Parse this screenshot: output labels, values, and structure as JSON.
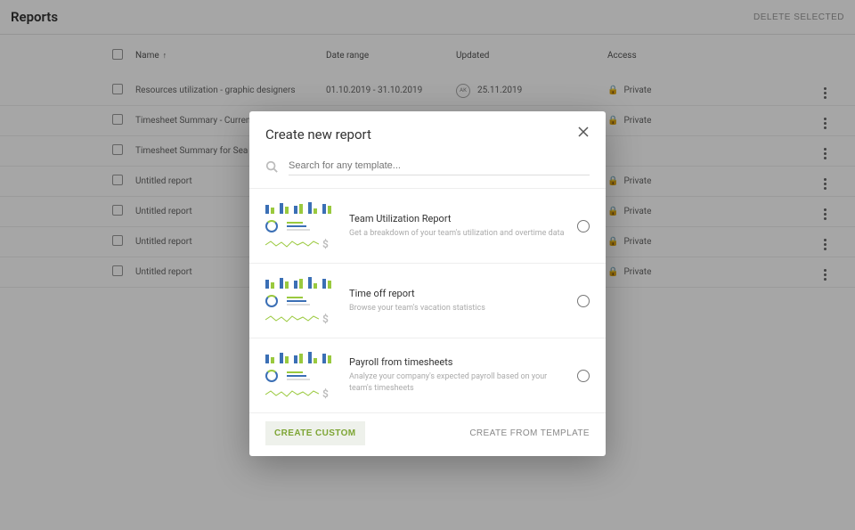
{
  "header": {
    "title": "Reports",
    "delete_label": "DELETE SELECTED"
  },
  "table": {
    "columns": {
      "name": "Name",
      "date_range": "Date range",
      "updated": "Updated",
      "access": "Access"
    },
    "rows": [
      {
        "name": "Resources utilization - graphic designers",
        "date_range": "01.10.2019 - 31.10.2019",
        "updated": "25.11.2019",
        "avatar": "AK",
        "access": "Private"
      },
      {
        "name": "Timesheet Summary - Current Month",
        "date_range": "",
        "updated": "",
        "avatar": "",
        "access": "Private"
      },
      {
        "name": "Timesheet Summary for Sea Hotels b",
        "date_range": "",
        "updated": "",
        "avatar": "",
        "access": ""
      },
      {
        "name": "Untitled report",
        "date_range": "",
        "updated": "",
        "avatar": "",
        "access": "Private"
      },
      {
        "name": "Untitled report",
        "date_range": "",
        "updated": "",
        "avatar": "",
        "access": "Private"
      },
      {
        "name": "Untitled report",
        "date_range": "",
        "updated": "",
        "avatar": "",
        "access": "Private"
      },
      {
        "name": "Untitled report",
        "date_range": "",
        "updated": "",
        "avatar": "",
        "access": "Private"
      }
    ]
  },
  "modal": {
    "title": "Create new report",
    "search_placeholder": "Search for any template...",
    "templates": [
      {
        "title": "Team Utilization Report",
        "desc": "Get a breakdown of your team's utilization and overtime data"
      },
      {
        "title": "Time off report",
        "desc": "Browse your team's vacation statistics"
      },
      {
        "title": "Payroll from timesheets",
        "desc": "Analyze your company's expected payroll based on your team's timesheets"
      }
    ],
    "create_custom": "CREATE CUSTOM",
    "create_from_template": "CREATE FROM TEMPLATE"
  }
}
